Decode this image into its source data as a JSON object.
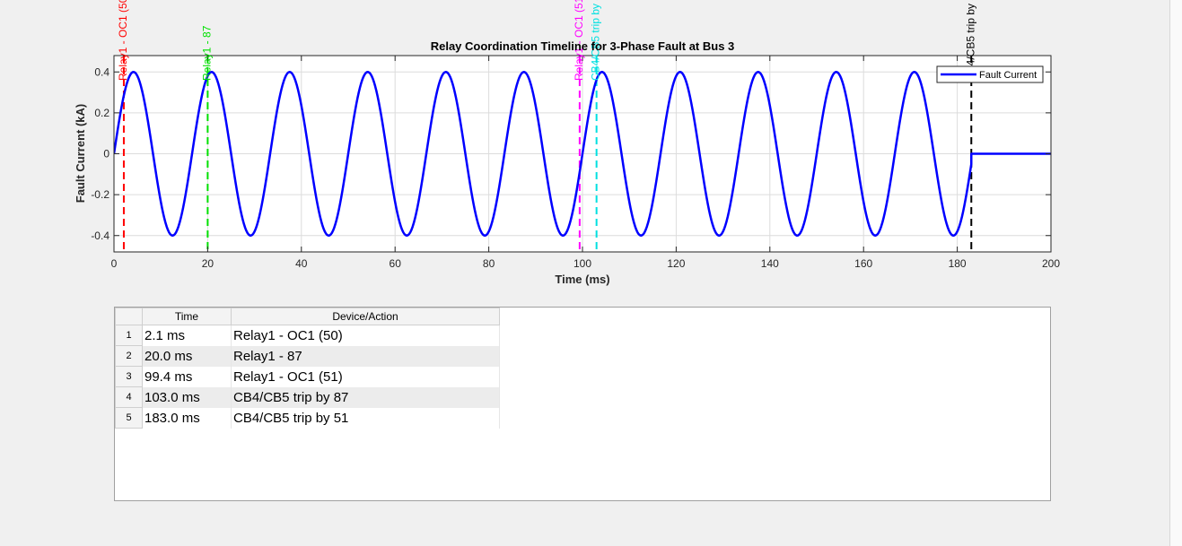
{
  "chart_data": {
    "type": "line",
    "title": "Relay Coordination Timeline for 3-Phase Fault at Bus 3",
    "xlabel": "Time (ms)",
    "ylabel": "Fault Current (kA)",
    "xlim": [
      0,
      200
    ],
    "ylim": [
      -0.48,
      0.48
    ],
    "xticks": [
      0,
      20,
      40,
      60,
      80,
      100,
      120,
      140,
      160,
      180,
      200
    ],
    "yticks": [
      -0.4,
      -0.2,
      0,
      0.2,
      0.4
    ],
    "ytick_labels": [
      "-0.4",
      "-0.2",
      "0",
      "0.2",
      "0.4"
    ],
    "grid": true,
    "legend_position": "top-right",
    "series": [
      {
        "name": "Fault Current",
        "color": "#0000ff",
        "function": "0.4*sin(2*pi*60*t) for t < 183.0 ms, 0 after",
        "amplitude_kA": 0.4,
        "frequency_Hz": 60,
        "interruption_time_ms": 183.0
      }
    ],
    "event_lines": [
      {
        "time_ms": 2.1,
        "label": "Relay1 - OC1 (50)",
        "color": "#ff0000"
      },
      {
        "time_ms": 20.0,
        "label": "Relay1 - 87",
        "color": "#00e000"
      },
      {
        "time_ms": 99.4,
        "label": "Relay1 - OC1 (51)",
        "color": "#ff00ff"
      },
      {
        "time_ms": 103.0,
        "label": "CB4/CB5 trip by 87",
        "color": "#00e0e0"
      },
      {
        "time_ms": 183.0,
        "label": "CB4/CB5 trip by 51",
        "color": "#000000"
      }
    ]
  },
  "table": {
    "columns": [
      "Time",
      "Device/Action"
    ],
    "rows": [
      {
        "num": "1",
        "time": "2.1 ms",
        "device": "Relay1 - OC1 (50)"
      },
      {
        "num": "2",
        "time": "20.0 ms",
        "device": "Relay1 - 87"
      },
      {
        "num": "3",
        "time": "99.4 ms",
        "device": "Relay1 - OC1 (51)"
      },
      {
        "num": "4",
        "time": "103.0 ms",
        "device": "CB4/CB5 trip by 87"
      },
      {
        "num": "5",
        "time": "183.0 ms",
        "device": "CB4/CB5 trip by 51"
      }
    ]
  }
}
